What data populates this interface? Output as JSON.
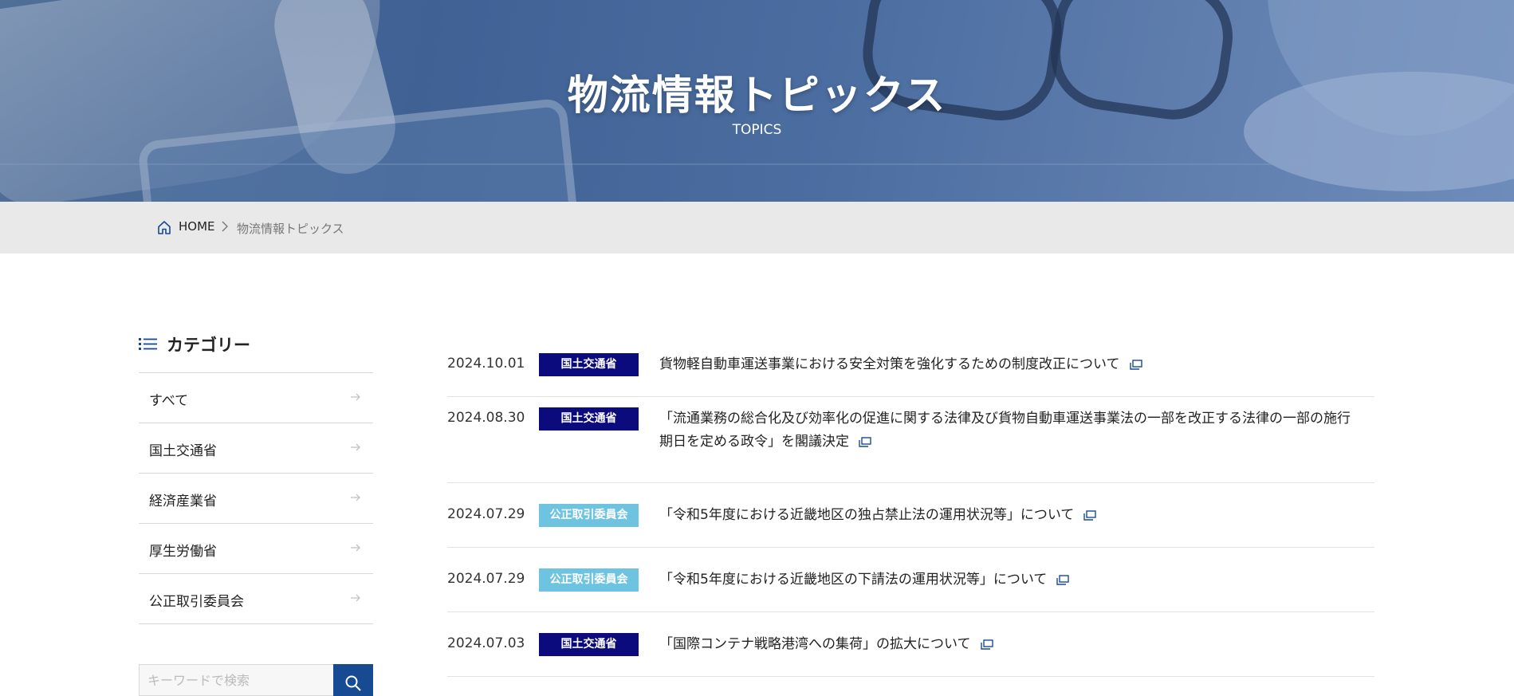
{
  "hero": {
    "title": "物流情報トピックス",
    "subtitle": "TOPICS"
  },
  "breadcrumb": {
    "home_label": "HOME",
    "current": "物流情報トピックス"
  },
  "sidebar": {
    "heading": "カテゴリー",
    "categories": [
      {
        "label": "すべて"
      },
      {
        "label": "国土交通省"
      },
      {
        "label": "経済産業省"
      },
      {
        "label": "厚生労働省"
      },
      {
        "label": "公正取引委員会"
      }
    ],
    "search_placeholder": "キーワードで検索"
  },
  "news": [
    {
      "date": "2024.10.01",
      "category": "国土交通省",
      "badge_color": "#0b0b7e",
      "title": "貨物軽自動車運送事業における安全対策を強化するための制度改正について"
    },
    {
      "date": "2024.08.30",
      "category": "国土交通省",
      "badge_color": "#0b0b7e",
      "title": "「流通業務の総合化及び効率化の促進に関する法律及び貨物自動車運送事業法の一部を改正する法律の一部の施行期日を定める政令」を閣議決定"
    },
    {
      "date": "2024.07.29",
      "category": "公正取引委員会",
      "badge_color": "#6ec3e0",
      "title": "「令和5年度における近畿地区の独占禁止法の運用状況等」について"
    },
    {
      "date": "2024.07.29",
      "category": "公正取引委員会",
      "badge_color": "#6ec3e0",
      "title": "「令和5年度における近畿地区の下請法の運用状況等」について"
    },
    {
      "date": "2024.07.03",
      "category": "国土交通省",
      "badge_color": "#0b0b7e",
      "title": "「国際コンテナ戦略港湾への集荷」の拡大について"
    }
  ],
  "colors": {
    "accent": "#164b93",
    "badge_mlit": "#0b0b7e",
    "badge_jftc": "#6ec3e0",
    "breadcrumb_bg": "#e9e9e9"
  },
  "icons": {
    "home": "home-icon",
    "list": "list-icon",
    "arrow": "arrow-right-icon",
    "external": "external-window-icon",
    "search": "search-icon"
  }
}
